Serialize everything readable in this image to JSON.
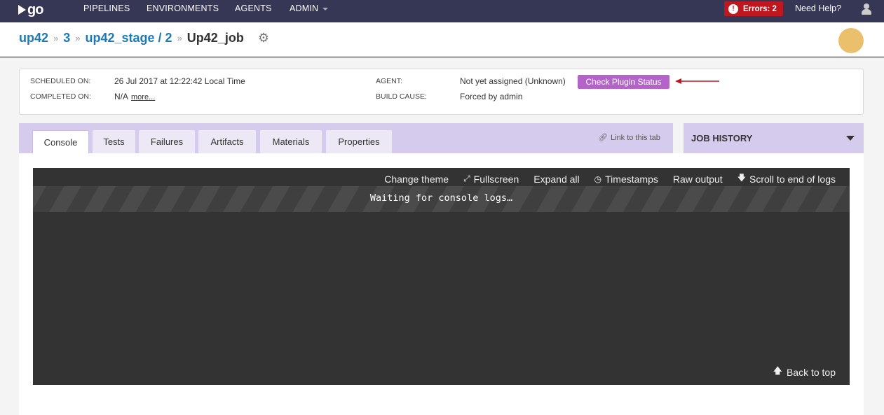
{
  "nav": {
    "logo": "go",
    "items": [
      "PIPELINES",
      "ENVIRONMENTS",
      "AGENTS",
      "ADMIN"
    ],
    "errors": "Errors: 2",
    "help": "Need Help?"
  },
  "breadcrumb": {
    "pipeline": "up42",
    "counter": "3",
    "stage": "up42_stage / 2",
    "job": "Up42_job"
  },
  "summary": {
    "scheduled_label": "SCHEDULED ON:",
    "scheduled_value": "26 Jul 2017 at 12:22:42 Local Time",
    "completed_label": "COMPLETED ON:",
    "completed_value": "N/A",
    "more_link": "more...",
    "agent_label": "AGENT:",
    "agent_value": "Not yet assigned (Unknown)",
    "plugin_button": "Check Plugin Status",
    "cause_label": "BUILD CAUSE:",
    "cause_value": "Forced by admin"
  },
  "tabs": [
    "Console",
    "Tests",
    "Failures",
    "Artifacts",
    "Materials",
    "Properties"
  ],
  "link_tab": "Link to this tab",
  "job_history": "JOB HISTORY",
  "console": {
    "change_theme": "Change theme",
    "fullscreen": "Fullscreen",
    "expand_all": "Expand all",
    "timestamps": "Timestamps",
    "raw_output": "Raw output",
    "scroll_end": "Scroll to end of logs",
    "waiting": "Waiting for console logs…",
    "back_to_top": "Back to top"
  },
  "colors": {
    "nav_bg": "#363655",
    "link": "#1e7ab5",
    "plugin_button": "#b464c9",
    "tab_bar": "#d5cbec",
    "errors": "#c0161d",
    "avatar": "#eac06d",
    "arrow": "#c0161d"
  },
  "icons": [
    "user-icon",
    "error-icon",
    "gear-icon",
    "link-icon",
    "expand-icon",
    "clock-icon",
    "arrow-down-icon",
    "arrow-up-icon"
  ]
}
